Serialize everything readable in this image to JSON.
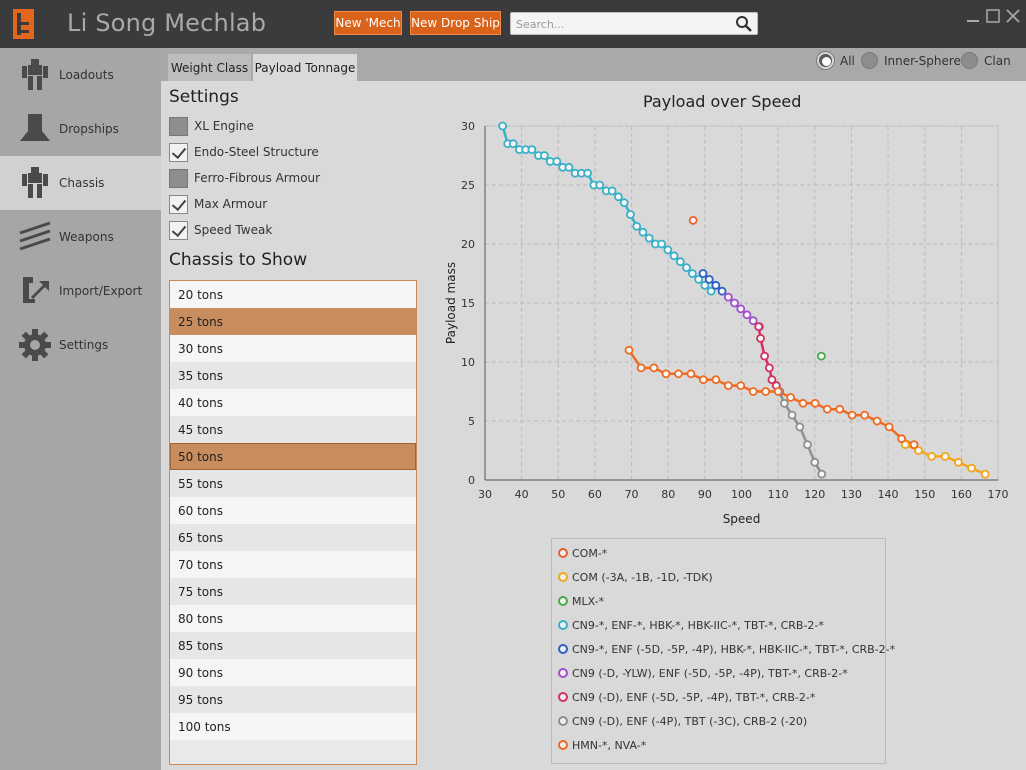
{
  "app": {
    "title": "Li Song Mechlab"
  },
  "toolbar": {
    "new_mech": "New 'Mech",
    "new_dropship": "New Drop Ship",
    "search_placeholder": "Search..."
  },
  "sidebar": {
    "items": [
      {
        "label": "Loadouts",
        "icon": "mech-icon"
      },
      {
        "label": "Dropships",
        "icon": "dropship-icon"
      },
      {
        "label": "Chassis",
        "icon": "mech-icon",
        "active": true
      },
      {
        "label": "Weapons",
        "icon": "weapons-icon"
      },
      {
        "label": "Import/Export",
        "icon": "import-export-icon"
      },
      {
        "label": "Settings",
        "icon": "gear-icon"
      }
    ]
  },
  "tabs": {
    "weight_class": "Weight Class",
    "payload_tonnage": "Payload Tonnage",
    "active": "Payload Tonnage"
  },
  "filter": {
    "all": "All",
    "inner_sphere": "Inner-Sphere",
    "clan": "Clan",
    "selected": "All"
  },
  "settings": {
    "heading": "Settings",
    "options": [
      {
        "label": "XL Engine",
        "checked": false
      },
      {
        "label": "Endo-Steel Structure",
        "checked": true
      },
      {
        "label": "Ferro-Fibrous Armour",
        "checked": false
      },
      {
        "label": "Max Armour",
        "checked": true
      },
      {
        "label": "Speed Tweak",
        "checked": true
      }
    ]
  },
  "chassis": {
    "heading": "Chassis to Show",
    "tonnages": [
      "20 tons",
      "25 tons",
      "30 tons",
      "35 tons",
      "40 tons",
      "45 tons",
      "50 tons",
      "55 tons",
      "60 tons",
      "65 tons",
      "70 tons",
      "75 tons",
      "80 tons",
      "85 tons",
      "90 tons",
      "95 tons",
      "100 tons"
    ],
    "selected": [
      "25 tons",
      "50 tons"
    ]
  },
  "chart_data": {
    "type": "scatter",
    "title": "Payload over Speed",
    "xlabel": "Speed",
    "ylabel": "Payload mass",
    "xlim": [
      30,
      170
    ],
    "ylim": [
      0,
      30
    ],
    "x_ticks": [
      30,
      40,
      50,
      60,
      70,
      80,
      90,
      100,
      110,
      120,
      130,
      140,
      150,
      160,
      170
    ],
    "y_ticks": [
      0,
      5,
      10,
      15,
      20,
      25,
      30
    ],
    "grid": true,
    "legend_position": "below",
    "series": [
      {
        "name": "COM-*",
        "color": "#e8602a",
        "connected": false,
        "points": [
          [
            86.8,
            22.0
          ]
        ]
      },
      {
        "name": "COM (-3A, -1B, -1D, -TDK)",
        "color": "#f2a51d",
        "connected": true,
        "points": [
          [
            144.7,
            3.0
          ],
          [
            148.3,
            2.5
          ],
          [
            151.9,
            2.0
          ],
          [
            155.6,
            2.0
          ],
          [
            159.2,
            1.5
          ],
          [
            162.8,
            1.0
          ],
          [
            166.5,
            0.5
          ]
        ]
      },
      {
        "name": "MLX-*",
        "color": "#4aaa4a",
        "connected": false,
        "points": [
          [
            121.8,
            10.5
          ]
        ]
      },
      {
        "name": "CN9-*, ENF-*, HBK-*, HBK-IIC-*, TBT-*, CRB-2-*",
        "color": "#3ab0c8",
        "connected": true,
        "points": [
          [
            34.8,
            30.0
          ],
          [
            36.2,
            28.5
          ],
          [
            37.7,
            28.5
          ],
          [
            39.4,
            28.0
          ],
          [
            41.1,
            28.0
          ],
          [
            42.8,
            28.0
          ],
          [
            44.6,
            27.5
          ],
          [
            46.2,
            27.5
          ],
          [
            47.8,
            27.0
          ],
          [
            49.6,
            27.0
          ],
          [
            51.2,
            26.5
          ],
          [
            52.9,
            26.5
          ],
          [
            54.6,
            26.0
          ],
          [
            56.3,
            26.0
          ],
          [
            58.0,
            26.0
          ],
          [
            59.7,
            25.0
          ],
          [
            61.3,
            25.0
          ],
          [
            63.1,
            24.5
          ],
          [
            64.7,
            24.5
          ],
          [
            66.4,
            24.0
          ],
          [
            68.0,
            23.5
          ],
          [
            69.7,
            22.5
          ],
          [
            71.4,
            21.5
          ],
          [
            73.1,
            21.0
          ],
          [
            74.8,
            20.5
          ],
          [
            76.5,
            20.0
          ],
          [
            78.2,
            20.0
          ],
          [
            79.9,
            19.5
          ],
          [
            81.6,
            19.0
          ],
          [
            83.3,
            18.5
          ],
          [
            85.0,
            18.0
          ],
          [
            86.6,
            17.5
          ],
          [
            88.3,
            17.0
          ],
          [
            90.0,
            16.5
          ],
          [
            91.7,
            16.0
          ]
        ]
      },
      {
        "name": "CN9-*, ENF (-5D, -5P, -4P), HBK-*, HBK-IIC-*, TBT-*, CRB-2-*",
        "color": "#2f5fc4",
        "connected": true,
        "points": [
          [
            89.5,
            17.5
          ],
          [
            91.2,
            17.0
          ],
          [
            93.0,
            16.5
          ],
          [
            94.7,
            16.0
          ]
        ]
      },
      {
        "name": "CN9 (-D, -YLW), ENF (-5D, -5P, -4P), TBT-*, CRB-2-*",
        "color": "#a24fcf",
        "connected": true,
        "points": [
          [
            96.4,
            15.5
          ],
          [
            98.1,
            15.0
          ],
          [
            99.8,
            14.5
          ],
          [
            101.5,
            14.0
          ],
          [
            103.2,
            13.5
          ],
          [
            104.9,
            13.0
          ]
        ]
      },
      {
        "name": "CN9 (-D), ENF (-5D, -5P, -4P), TBT-*, CRB-2-*",
        "color": "#d3305e",
        "connected": true,
        "points": [
          [
            104.7,
            13.0
          ],
          [
            105.2,
            12.0
          ],
          [
            106.3,
            10.5
          ],
          [
            107.6,
            9.5
          ],
          [
            108.3,
            8.5
          ],
          [
            109.5,
            8.0
          ],
          [
            110.4,
            7.5
          ]
        ]
      },
      {
        "name": "CN9 (-D), ENF (-4P), TBT (-3C), CRB-2 (-20)",
        "color": "#8f8f8f",
        "connected": true,
        "points": [
          [
            110.3,
            7.5
          ],
          [
            111.7,
            6.5
          ],
          [
            113.8,
            5.5
          ],
          [
            115.9,
            4.5
          ],
          [
            118.0,
            3.0
          ],
          [
            120.0,
            1.5
          ],
          [
            121.9,
            0.5
          ]
        ]
      },
      {
        "name": "HMN-*, NVA-*",
        "color": "#ef6a22",
        "connected": true,
        "points": [
          [
            69.3,
            11.0
          ],
          [
            72.6,
            9.5
          ],
          [
            76.1,
            9.5
          ],
          [
            79.4,
            9.0
          ],
          [
            82.8,
            9.0
          ],
          [
            86.2,
            9.0
          ],
          [
            89.6,
            8.5
          ],
          [
            93.0,
            8.5
          ],
          [
            96.4,
            8.0
          ],
          [
            99.8,
            8.0
          ],
          [
            103.2,
            7.5
          ],
          [
            106.6,
            7.5
          ],
          [
            110.0,
            7.5
          ],
          [
            113.4,
            7.0
          ],
          [
            116.8,
            6.5
          ],
          [
            120.1,
            6.5
          ],
          [
            123.4,
            6.0
          ],
          [
            126.8,
            6.0
          ],
          [
            130.2,
            5.5
          ],
          [
            133.6,
            5.5
          ],
          [
            137.0,
            5.0
          ],
          [
            140.3,
            4.5
          ],
          [
            143.7,
            3.5
          ],
          [
            147.1,
            3.0
          ]
        ]
      }
    ]
  }
}
